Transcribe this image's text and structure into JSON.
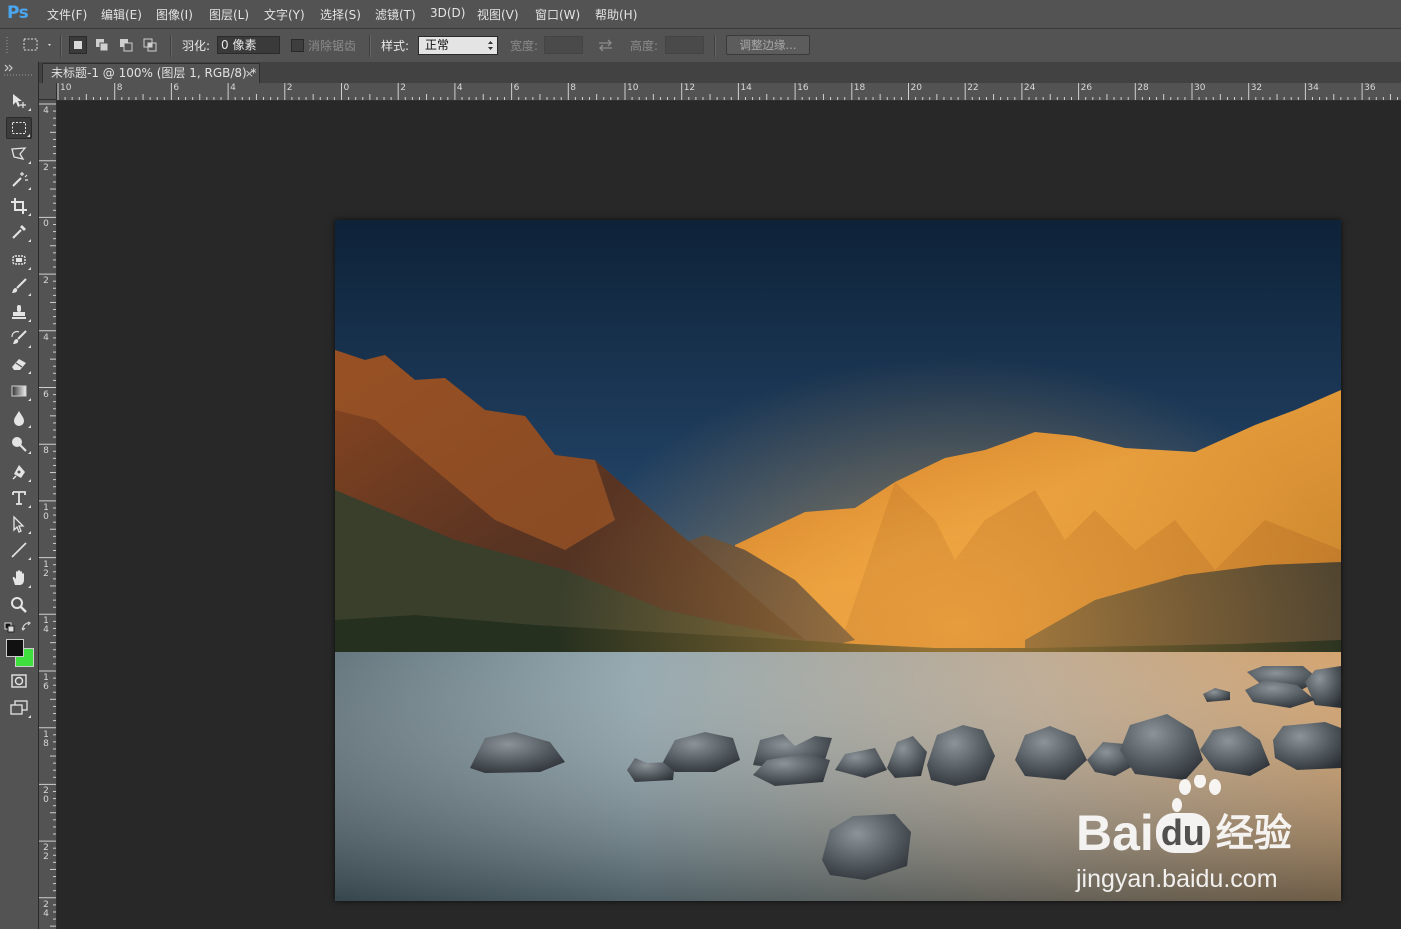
{
  "app": {
    "logo": "Ps"
  },
  "menu": [
    {
      "label": "文件(F)"
    },
    {
      "label": "编辑(E)"
    },
    {
      "label": "图像(I)"
    },
    {
      "label": "图层(L)"
    },
    {
      "label": "文字(Y)"
    },
    {
      "label": "选择(S)"
    },
    {
      "label": "滤镜(T)"
    },
    {
      "label": "3D(D)"
    },
    {
      "label": "视图(V)"
    },
    {
      "label": "窗口(W)"
    },
    {
      "label": "帮助(H)"
    }
  ],
  "options": {
    "feather_label": "羽化:",
    "feather_value": "0 像素",
    "antialias_label": "消除锯齿",
    "style_label": "样式:",
    "style_value": "正常",
    "width_label": "宽度:",
    "height_label": "高度:",
    "refine_edge_label": "调整边缘..."
  },
  "document": {
    "tab_title": "未标题-1 @ 100% (图层 1, RGB/8) *",
    "close_glyph": "×"
  },
  "rulers": {
    "horizontal": [
      "10",
      "8",
      "6",
      "4",
      "2",
      "0",
      "2",
      "4",
      "6",
      "8",
      "10",
      "12",
      "14",
      "16",
      "18",
      "20",
      "22",
      "24",
      "26",
      "28",
      "30",
      "32",
      "34",
      "36"
    ],
    "vertical": [
      "4",
      "2",
      "0",
      "2",
      "4",
      "6",
      "8",
      "10",
      "12",
      "14",
      "16",
      "18",
      "20",
      "22",
      "24"
    ]
  },
  "tools": [
    "move-tool",
    "marquee-tool",
    "lasso-tool",
    "magic-wand-tool",
    "crop-tool",
    "eyedropper-tool",
    "healing-brush-tool",
    "brush-tool",
    "clone-stamp-tool",
    "history-brush-tool",
    "eraser-tool",
    "gradient-tool",
    "blur-tool",
    "dodge-tool",
    "pen-tool",
    "type-tool",
    "path-selection-tool",
    "line-tool",
    "hand-tool",
    "zoom-tool"
  ],
  "colors": {
    "foreground": "#111111",
    "background": "#3ee03e",
    "accent": "#4aa6f0"
  },
  "watermark": {
    "brand": "Bai",
    "brand2": "du",
    "cn": "经验",
    "url": "jingyan.baidu.com"
  }
}
